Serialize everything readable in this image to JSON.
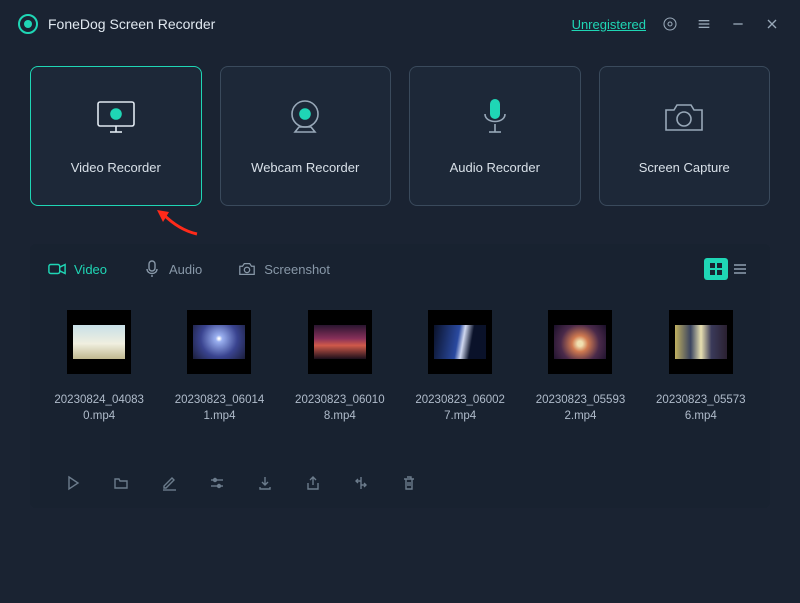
{
  "app": {
    "title": "FoneDog Screen Recorder",
    "unregistered_label": "Unregistered"
  },
  "modes": {
    "video": "Video Recorder",
    "webcam": "Webcam Recorder",
    "audio": "Audio Recorder",
    "capture": "Screen Capture"
  },
  "tabs": {
    "video": "Video",
    "audio": "Audio",
    "screenshot": "Screenshot"
  },
  "files": [
    {
      "name": "20230824_040830.mp4"
    },
    {
      "name": "20230823_060141.mp4"
    },
    {
      "name": "20230823_060108.mp4"
    },
    {
      "name": "20230823_060027.mp4"
    },
    {
      "name": "20230823_055932.mp4"
    },
    {
      "name": "20230823_055736.mp4"
    }
  ]
}
